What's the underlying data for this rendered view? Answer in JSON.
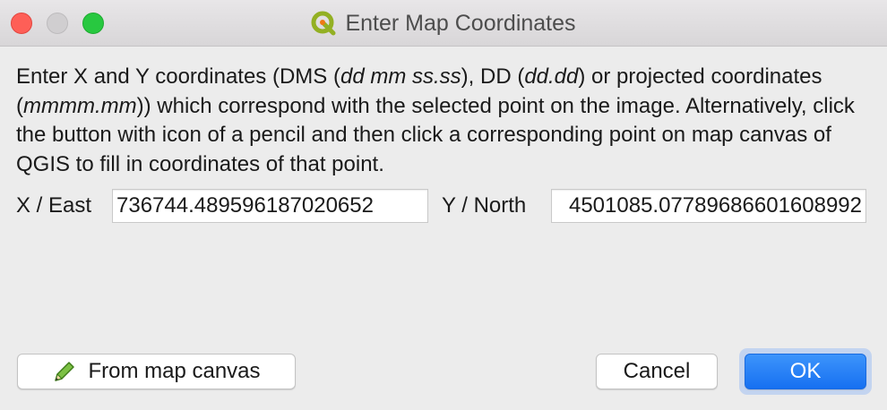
{
  "window": {
    "title": "Enter Map Coordinates",
    "app_icon": "qgis-icon"
  },
  "description": {
    "p1": "Enter X and Y coordinates (DMS (",
    "i1": "dd mm ss.ss",
    "p2": "), DD (",
    "i2": "dd.dd",
    "p3": ") or projected coordinates (",
    "i3": "mmmm.mm",
    "p4": ")) which correspond with the selected point on the image. Alternatively, click the button with icon of a pencil and then click a corresponding point on map canvas of QGIS to fill in coordinates of that point."
  },
  "coords": {
    "x_label": "X / East",
    "x_value": "736744.489596187020652",
    "y_label": "Y / North",
    "y_value": "4501085.07789686601608992"
  },
  "buttons": {
    "from_canvas": "From map canvas",
    "from_canvas_icon": "pencil-icon",
    "cancel": "Cancel",
    "ok": "OK"
  },
  "colors": {
    "close": "#fe5f57",
    "maximize": "#28c840",
    "ok_button": "#1f7cf4"
  }
}
